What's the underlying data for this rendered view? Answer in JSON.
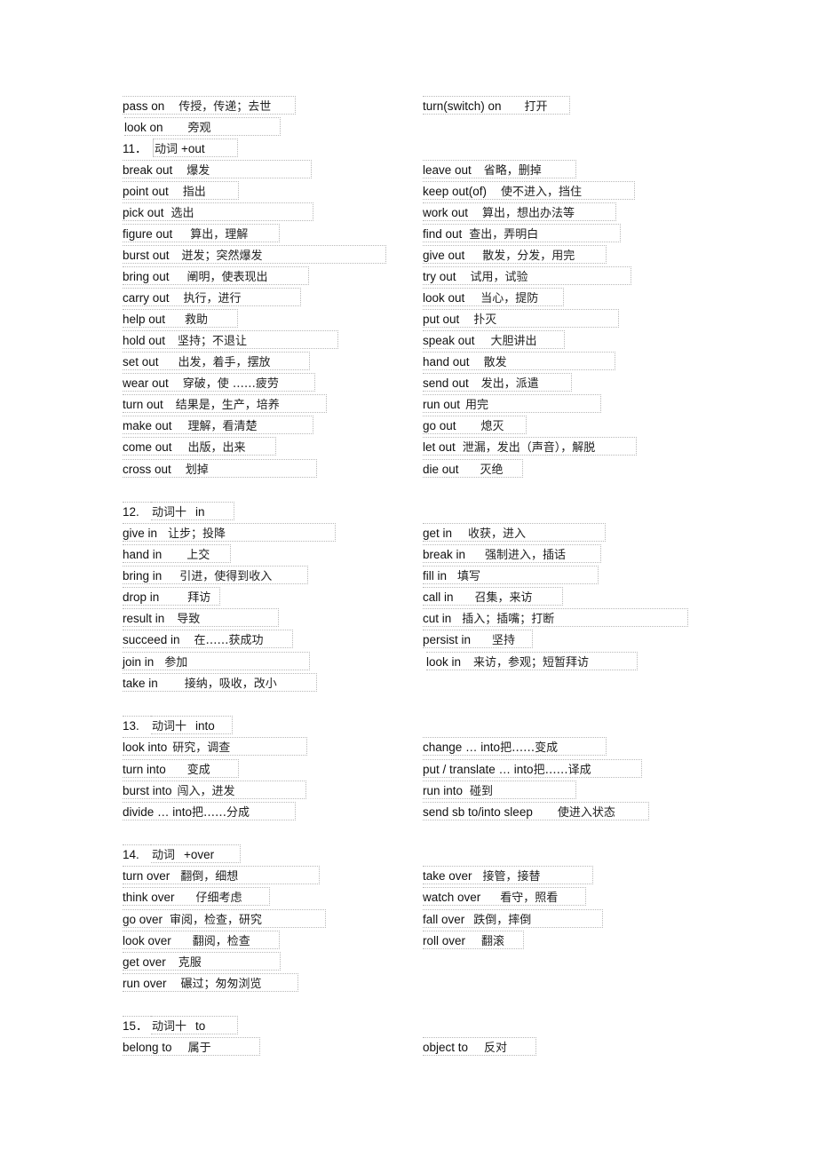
{
  "rows_top": {
    "left": [
      {
        "en": "pass on",
        "zh": "传授，传递；去世"
      },
      {
        "en": "look on",
        "zh": "旁观"
      }
    ],
    "right": [
      {
        "en": "turn(switch) on",
        "zh": "打开"
      }
    ]
  },
  "sections": [
    {
      "number": "11．",
      "label_zh": "动词",
      "label_en": "+out",
      "left": [
        {
          "en": "break out",
          "zh": "爆发"
        },
        {
          "en": "point out",
          "zh": "指出"
        },
        {
          "en": "pick out",
          "zh": "选出"
        },
        {
          "en": "figure out",
          "zh": "算出，理解"
        },
        {
          "en": "burst out",
          "zh": "迸发；突然爆发"
        },
        {
          "en": "bring out",
          "zh": "阐明，使表现出"
        },
        {
          "en": "carry out",
          "zh": "执行，进行"
        },
        {
          "en": "help out",
          "zh": "救助"
        },
        {
          "en": "hold out",
          "zh": "坚持；不退让"
        },
        {
          "en": "set out",
          "zh": "出发，着手，摆放"
        },
        {
          "en": "wear out",
          "zh": "穿破，使 ……疲劳"
        },
        {
          "en": "turn out",
          "zh": "结果是，生产，培养"
        },
        {
          "en": "make out",
          "zh": "理解，看清楚"
        },
        {
          "en": "come out",
          "zh": "出版，出来"
        },
        {
          "en": "cross out",
          "zh": "划掉"
        }
      ],
      "right": [
        {
          "en": "leave out",
          "zh": "省略，删掉"
        },
        {
          "en": "keep out(of)",
          "zh": "使不进入，挡住"
        },
        {
          "en": "work out",
          "zh": "算出，想出办法等"
        },
        {
          "en": "find out",
          "zh": "查出，弄明白"
        },
        {
          "en": "give out",
          "zh": "散发，分发，用完"
        },
        {
          "en": "try out",
          "zh": "试用，试验"
        },
        {
          "en": "look out",
          "zh": "当心，提防"
        },
        {
          "en": "put out",
          "zh": "扑灭"
        },
        {
          "en": "speak out",
          "zh": "大胆讲出"
        },
        {
          "en": "hand out",
          "zh": "散发"
        },
        {
          "en": "send out",
          "zh": "发出，派遣"
        },
        {
          "en": "run out",
          "zh": "用完"
        },
        {
          "en": "go out",
          "zh": "熄灭"
        },
        {
          "en": "let out",
          "zh": "泄漏，发出（声音），解脱"
        },
        {
          "en": "die out",
          "zh": "灭绝"
        }
      ]
    },
    {
      "number": "12.",
      "label_zh": "动词十",
      "label_en": "in",
      "left": [
        {
          "en": "give in",
          "zh": "让步；投降"
        },
        {
          "en": "hand in",
          "zh": "上交"
        },
        {
          "en": "bring in",
          "zh": "引进，使得到收入"
        },
        {
          "en": "drop in",
          "zh": "拜访"
        },
        {
          "en": "result in",
          "zh": "导致"
        },
        {
          "en": "succeed in",
          "zh": "在……获成功"
        },
        {
          "en": "join in",
          "zh": "参加"
        },
        {
          "en": "take in",
          "zh": "接纳，吸收，改小"
        }
      ],
      "right": [
        {
          "en": "get in",
          "zh": "收获，进入"
        },
        {
          "en": "break in",
          "zh": "强制进入，插话"
        },
        {
          "en": "fill in",
          "zh": "填写"
        },
        {
          "en": "call in",
          "zh": "召集，来访"
        },
        {
          "en": "cut in",
          "zh": "插入；插嘴；打断"
        },
        {
          "en": "persist in",
          "zh": "坚持"
        },
        {
          "en": "look in",
          "zh": "来访，参观；短暂拜访"
        }
      ]
    },
    {
      "number": "13.",
      "label_zh": "动词十",
      "label_en": "into",
      "left": [
        {
          "en": "look into",
          "zh": "研究，调查"
        },
        {
          "en": "turn into",
          "zh": "变成"
        },
        {
          "en": "burst into",
          "zh": "闯入，进发"
        },
        {
          "en": "divide … into",
          "zh": "把……分成"
        }
      ],
      "right": [
        {
          "en": "change … into",
          "zh": "把……变成"
        },
        {
          "en": "put / translate … into",
          "zh": "把……译成"
        },
        {
          "en": "run into",
          "zh": "碰到"
        },
        {
          "en": "send sb to/into sleep",
          "zh": "使进入状态"
        }
      ]
    },
    {
      "number": "14.",
      "label_zh": "动词",
      "label_en": "+over",
      "left": [
        {
          "en": "turn over",
          "zh": "翻倒，细想"
        },
        {
          "en": "think over",
          "zh": "仔细考虑"
        },
        {
          "en": "go over",
          "zh": "审阅，检查，研究"
        },
        {
          "en": "look over",
          "zh": "翻阅，检查"
        },
        {
          "en": "get over",
          "zh": "克服"
        },
        {
          "en": "run over",
          "zh": "碾过；匆匆浏览"
        }
      ],
      "right": [
        {
          "en": "take over",
          "zh": "接管，接替"
        },
        {
          "en": "watch over",
          "zh": "看守，照看"
        },
        {
          "en": "fall over",
          "zh": "跌倒，摔倒"
        },
        {
          "en": "roll over",
          "zh": "翻滚"
        }
      ]
    },
    {
      "number": "15．",
      "label_zh": "动词十",
      "label_en": "to",
      "left": [
        {
          "en": "belong to",
          "zh": "属于"
        }
      ],
      "right": [
        {
          "en": "object to",
          "zh": "反对"
        }
      ]
    }
  ]
}
